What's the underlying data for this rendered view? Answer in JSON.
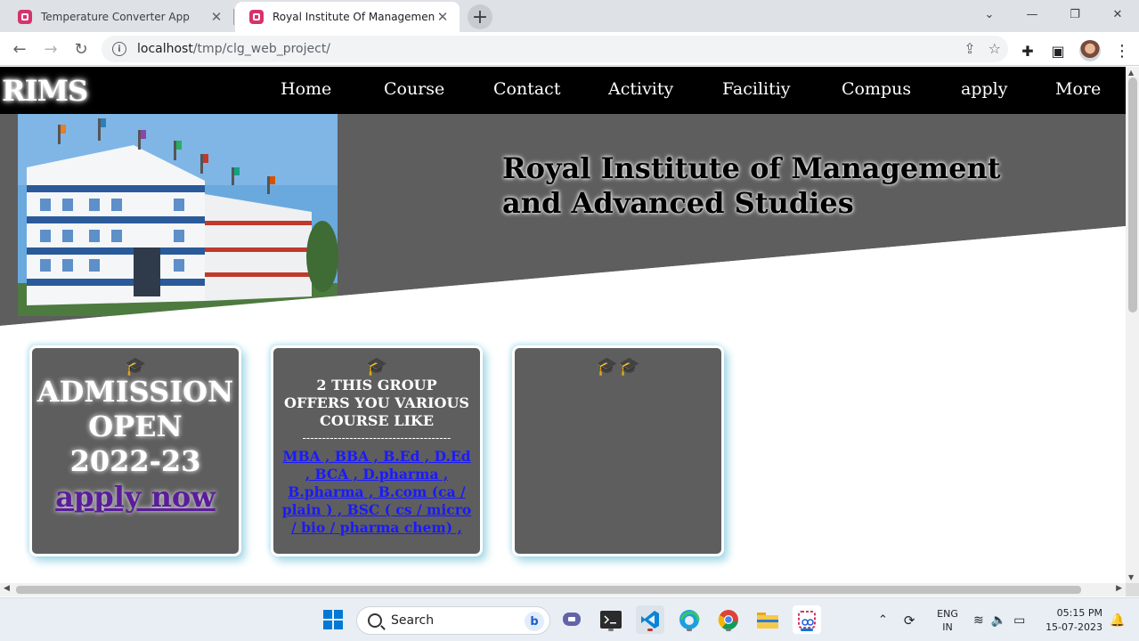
{
  "browser": {
    "tabs": [
      {
        "title": "Temperature Converter App",
        "active": false
      },
      {
        "title": "Royal Institute Of Management & Advanced Studies",
        "active": true
      }
    ],
    "url_host": "localhost",
    "url_path": "/tmp/clg_web_project/"
  },
  "site": {
    "logo": "RIMS",
    "nav": [
      "Home",
      "Course",
      "Contact",
      "Activity",
      "Facilitiy",
      "Compus",
      "apply",
      "More"
    ],
    "hero_title": "Royal Institute of Management and Advanced Studies",
    "card1": {
      "line1": "ADMISSION",
      "line2": "OPEN",
      "line3": "2022-23",
      "link": "apply now"
    },
    "card2": {
      "heading": "2 THIS GROUP OFFERS YOU VARIOUS COURSE LIKE",
      "divider": "--------------------------------------",
      "courses": "MBA , BBA , B.Ed , D.Ed , BCA , D.pharma , B.pharma , B.com (ca / plain ) , BSC ( cs / micro / bio / pharma chem) ,"
    },
    "colors": {
      "nav_bg": "#000000",
      "hero_bg": "#5e5e5e",
      "card_bg": "#5e5e5e",
      "card_glow": "#9bd4e4",
      "apply_link": "#5a1d9a",
      "course_link": "#1a1aff"
    }
  },
  "taskbar": {
    "search_placeholder": "Search",
    "lang_top": "ENG",
    "lang_bottom": "IN",
    "time": "05:15 PM",
    "date": "15-07-2023"
  }
}
